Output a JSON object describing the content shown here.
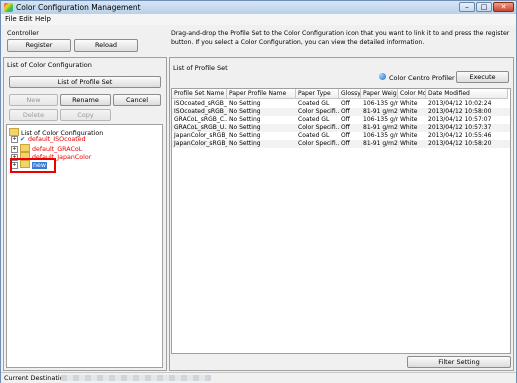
{
  "window": {
    "title": "Color Configuration Management"
  },
  "menu": [
    "File",
    "Edit",
    "Help"
  ],
  "controller": {
    "label": "Controller",
    "register": "Register",
    "reload": "Reload"
  },
  "instructions": "Drag-and-drop the Profile Set to the Color Configuration icon that you want to link it to and press the register button. If you select a Color Configuration, you can view the detailed information.",
  "left": {
    "title": "List of Color Configuration",
    "list_btn": "List of Profile Set",
    "new": "New",
    "rename": "Rename",
    "cancel": "Cancel",
    "delete": "Delete",
    "copy": "Copy",
    "tree": {
      "root": "List of Color Configuration",
      "items": [
        "default_ISOcoated",
        "default_GRACoL",
        "default_JapanColor",
        "new"
      ]
    }
  },
  "right": {
    "title": "List of Profile Set",
    "profiler_label": "Color Centro Profiler :",
    "execute": "Execute",
    "columns": [
      "Profile Set Name",
      "Paper Profile Name",
      "Paper Type",
      "Glossy",
      "Paper Weight",
      "Color Mode",
      "Date Modified"
    ],
    "rows": [
      [
        "ISOcoated_sRGB_...",
        "No Setting",
        "Coated GL",
        "Off",
        "106-135 g/m...",
        "White",
        "2013/04/12 10:02:24"
      ],
      [
        "ISOcoated_sRGB_...",
        "No Setting",
        "Color Specifi...",
        "Off",
        "81-91 g/m2",
        "White",
        "2013/04/12 10:58:00"
      ],
      [
        "GRACoL_sRGB_C...",
        "No Setting",
        "Coated GL",
        "Off",
        "106-135 g/m...",
        "White",
        "2013/04/12 10:57:07"
      ],
      [
        "GRACoL_sRGB_U...",
        "No Setting",
        "Color Specifi...",
        "Off",
        "81-91 g/m2",
        "White",
        "2013/04/12 10:57:37"
      ],
      [
        "JapanColor_sRGB_...",
        "No Setting",
        "Coated GL",
        "Off",
        "106-135 g/m...",
        "White",
        "2013/04/12 10:55:46"
      ],
      [
        "JapanColor_sRGB_...",
        "No Setting",
        "Color Specifi...",
        "Off",
        "81-91 g/m2",
        "White",
        "2013/04/12 10:58:20"
      ]
    ],
    "filter": "Filter Setting"
  },
  "status": {
    "label": "Current Destination"
  }
}
